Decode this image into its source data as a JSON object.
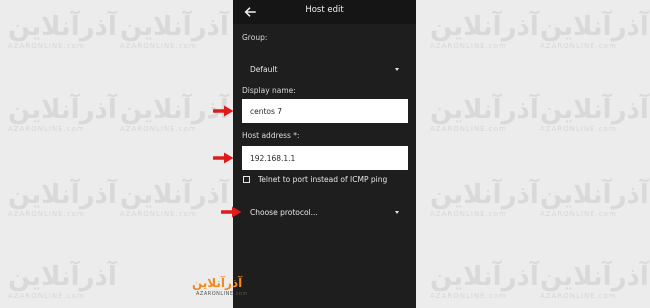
{
  "appbar": {
    "title": "Host edit",
    "back_icon": "arrow-left-icon"
  },
  "form": {
    "group_label": "Group:",
    "group_value": "Default",
    "display_name_label": "Display name:",
    "display_name_value": "centos 7",
    "host_address_label": "Host address *:",
    "host_address_value": "192.168.1.1",
    "telnet_checkbox_label": "Telnet to port instead of ICMP ping",
    "telnet_checked": false,
    "protocol_placeholder": "Choose protocol..."
  },
  "annotations": {
    "arrow_color": "#e01b1b"
  },
  "watermark": {
    "brand": "آذرآنلاین",
    "sub": "AZARONLINE.com"
  },
  "logo": {
    "text": "آذرآنلاین",
    "sub": "AZARONLINE.com",
    "color": "#f08a1e"
  }
}
